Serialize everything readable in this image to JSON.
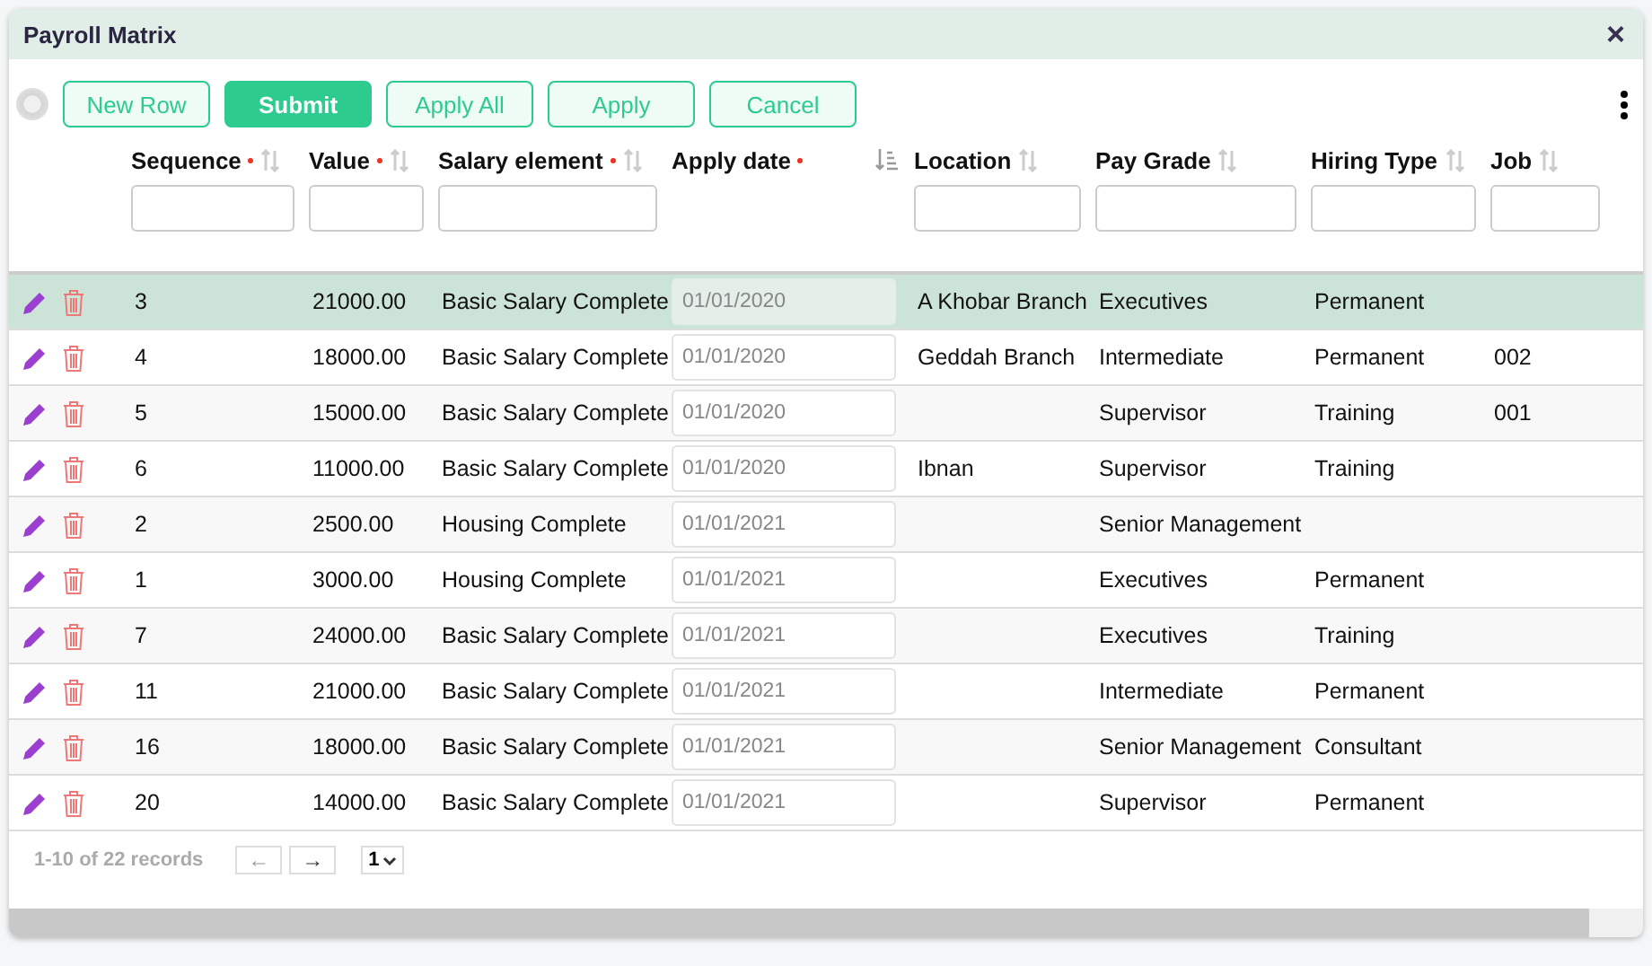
{
  "window": {
    "title": "Payroll Matrix",
    "close": "×"
  },
  "toolbar": {
    "radio": {
      "checked": false
    },
    "buttons": [
      {
        "label": "New Row",
        "kind": "outline"
      },
      {
        "label": "Submit",
        "kind": "primary"
      },
      {
        "label": "Apply All",
        "kind": "outline"
      },
      {
        "label": "Apply",
        "kind": "outline"
      },
      {
        "label": "Cancel",
        "kind": "outline"
      }
    ]
  },
  "table": {
    "columns": [
      {
        "label": "Sequence",
        "required": true,
        "sorted": false,
        "filter": true
      },
      {
        "label": "Value",
        "required": true,
        "sorted": false,
        "filter": true
      },
      {
        "label": "Salary element",
        "required": true,
        "sorted": false,
        "filter": true
      },
      {
        "label": "Apply date",
        "required": true,
        "sorted": true,
        "filter": false
      },
      {
        "label": "Location",
        "required": false,
        "sorted": false,
        "filter": true
      },
      {
        "label": "Pay Grade",
        "required": false,
        "sorted": false,
        "filter": true
      },
      {
        "label": "Hiring Type",
        "required": false,
        "sorted": false,
        "filter": true
      },
      {
        "label": "Job",
        "required": false,
        "sorted": false,
        "filter": true
      }
    ],
    "rows": [
      {
        "selected": true,
        "cells": [
          "3",
          "21000.00",
          "Basic Salary Complete",
          "01/01/2020",
          "A Khobar Branch",
          "Executives",
          "Permanent",
          ""
        ]
      },
      {
        "selected": false,
        "cells": [
          "4",
          "18000.00",
          "Basic Salary Complete",
          "01/01/2020",
          "Geddah Branch",
          "Intermediate",
          "Permanent",
          "002"
        ]
      },
      {
        "selected": false,
        "cells": [
          "5",
          "15000.00",
          "Basic Salary Complete",
          "01/01/2020",
          "",
          "Supervisor",
          "Training",
          "001"
        ]
      },
      {
        "selected": false,
        "cells": [
          "6",
          "11000.00",
          "Basic Salary Complete",
          "01/01/2020",
          "Ibnan",
          "Supervisor",
          "Training",
          ""
        ]
      },
      {
        "selected": false,
        "cells": [
          "2",
          "2500.00",
          "Housing Complete",
          "01/01/2021",
          "",
          "Senior Management",
          "",
          ""
        ]
      },
      {
        "selected": false,
        "cells": [
          "1",
          "3000.00",
          "Housing Complete",
          "01/01/2021",
          "",
          "Executives",
          "Permanent",
          ""
        ]
      },
      {
        "selected": false,
        "cells": [
          "7",
          "24000.00",
          "Basic Salary Complete",
          "01/01/2021",
          "",
          "Executives",
          "Training",
          ""
        ]
      },
      {
        "selected": false,
        "cells": [
          "11",
          "21000.00",
          "Basic Salary Complete",
          "01/01/2021",
          "",
          "Intermediate",
          "Permanent",
          ""
        ]
      },
      {
        "selected": false,
        "cells": [
          "16",
          "18000.00",
          "Basic Salary Complete",
          "01/01/2021",
          "",
          "Senior Management",
          "Consultant",
          ""
        ]
      },
      {
        "selected": false,
        "cells": [
          "20",
          "14000.00",
          "Basic Salary Complete",
          "01/01/2021",
          "",
          "Supervisor",
          "Permanent",
          ""
        ]
      }
    ]
  },
  "pagination": {
    "summary": "1-10 of 22 records",
    "prev": "←",
    "next": "→",
    "page": "1"
  }
}
